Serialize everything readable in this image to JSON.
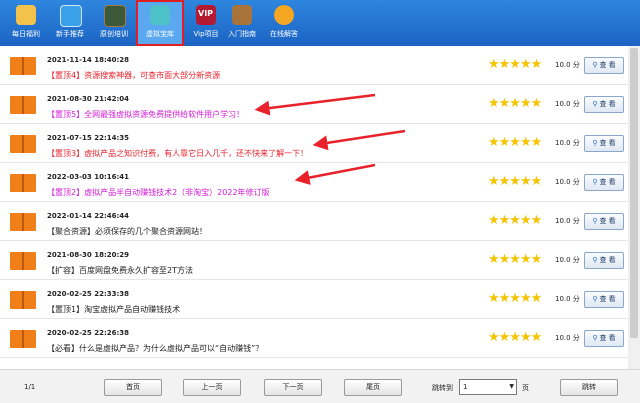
{
  "nav": [
    {
      "label": "每日福利",
      "icon": "lucky-cat-icon",
      "color": "#f3c24a"
    },
    {
      "label": "新手推荐",
      "icon": "monitor-icon",
      "color": "#3aa0e8"
    },
    {
      "label": "原创培训",
      "icon": "chalkboard-icon",
      "color": "#3c5a3a"
    },
    {
      "label": "虚拟宝库",
      "icon": "treasure-icon",
      "color": "#4ec0c8",
      "active": true
    },
    {
      "label": "Vip项目",
      "icon": "vip-icon",
      "color": "#b31a2f"
    },
    {
      "label": "入门指南",
      "icon": "book-icon",
      "color": "#a8743a"
    },
    {
      "label": "在线解答",
      "icon": "support-girl-icon",
      "color": "#f5a623"
    }
  ],
  "rows": [
    {
      "date": "2021-11-14 18:40:28",
      "title": "【置顶4】资源搜索神器，可查市面大部分新资源",
      "style": "red",
      "score": "10.0 分"
    },
    {
      "date": "2021-08-30 21:42:04",
      "title": "【置顶5】全网最强虚拟资源免费提供给软件用户学习！",
      "style": "pink",
      "score": "10.0 分"
    },
    {
      "date": "2021-07-15 22:14:35",
      "title": "【置顶3】虚拟产品之知识付费，有人靠它日入几千，还不快来了解一下！",
      "style": "red",
      "score": "10.0 分"
    },
    {
      "date": "2022-03-03 10:16:41",
      "title": "【置顶2】虚拟产品半自动赚钱技术2（非淘宝）2022年修订版",
      "style": "pink",
      "score": "10.0 分"
    },
    {
      "date": "2022-01-14 22:46:44",
      "title": "【聚合资源】必须保存的几个聚合资源网站！",
      "style": "normal",
      "score": "10.0 分"
    },
    {
      "date": "2021-08-30 18:20:29",
      "title": "【扩容】百度网盘免费永久扩容至2T方法",
      "style": "normal",
      "score": "10.0 分"
    },
    {
      "date": "2020-02-25 22:33:38",
      "title": "【置顶1】淘宝虚拟产品自动赚钱技术",
      "style": "normal",
      "score": "10.0 分"
    },
    {
      "date": "2020-02-25 22:26:38",
      "title": "【必看】什么是虚拟产品？为什么虚拟产品可以“自动赚钱”？",
      "style": "normal",
      "score": "10.0 分"
    }
  ],
  "stars_text": "★★★★★",
  "rating": {
    "value": 5,
    "max": 5
  },
  "view_button_label": "查 看",
  "view_icon": "magnifier-icon",
  "footer": {
    "page_info": "1/1",
    "first": "首页",
    "prev": "上一页",
    "next": "下一页",
    "last": "尾页",
    "jump_label": "跳转到",
    "page_select": "1",
    "page_suffix": "页",
    "jump_button": "跳转"
  },
  "colors": {
    "topbar": "#1c64c4",
    "title_red": "#e8212b",
    "title_pink": "#d21ad6",
    "star": "#f5c400",
    "book": "#f07f1a",
    "arrow": "#e8212b"
  }
}
